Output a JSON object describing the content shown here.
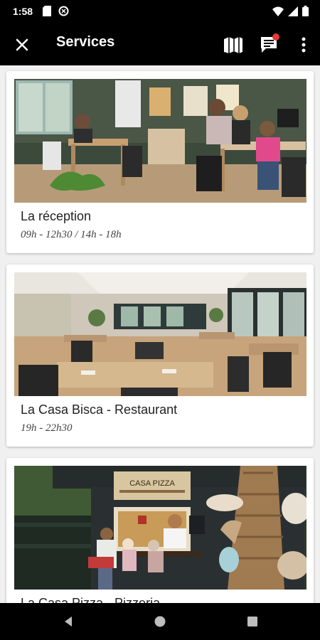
{
  "status_bar": {
    "time": "1:58"
  },
  "app_bar": {
    "title": "Services",
    "close_icon": "close-icon",
    "map_icon": "map-icon",
    "chat_icon": "chat-notification-icon",
    "menu_icon": "more-vert-icon"
  },
  "services": [
    {
      "title": "La réception",
      "hours": "09h - 12h30 / 14h - 18h"
    },
    {
      "title": "La Casa Bisca - Restaurant",
      "hours": "19h - 22h30"
    },
    {
      "title": "La Casa Pizza - Pizzeria",
      "hours": "",
      "sign_text": "CASA PIZZA"
    }
  ],
  "colors": {
    "app_bar": "#000000",
    "background": "#f0f0f0",
    "card": "#ffffff",
    "notification_dot": "#e53935"
  }
}
